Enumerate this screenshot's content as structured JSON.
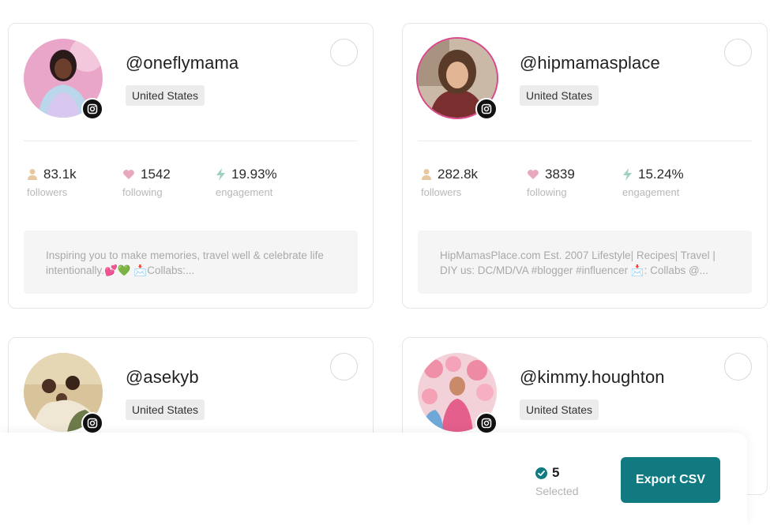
{
  "profiles": [
    {
      "handle": "@oneflymama",
      "country": "United States",
      "followers": "83.1k",
      "following": "1542",
      "engagement": "19.93%",
      "bio": "Inspiring you to make memories, travel well & celebrate life intentionally.💕💚 📩Collabs:...",
      "platform_icon": "instagram-icon"
    },
    {
      "handle": "@hipmamasplace",
      "country": "United States",
      "followers": "282.8k",
      "following": "3839",
      "engagement": "15.24%",
      "bio": "HipMamasPlace.com Est. 2007 Lifestyle| Recipes| Travel | DIY us: DC/MD/VA #blogger #influencer 📩: Collabs @...",
      "platform_icon": "instagram-icon"
    },
    {
      "handle": "@asekyb",
      "country": "United States",
      "platform_icon": "instagram-icon"
    },
    {
      "handle": "@kimmy.houghton",
      "country": "United States",
      "platform_icon": "instagram-icon"
    }
  ],
  "labels": {
    "followers": "followers",
    "following": "following",
    "engagement": "engagement"
  },
  "footer": {
    "selected_count": "5",
    "selected_label": "Selected",
    "export_label": "Export CSV"
  },
  "colors": {
    "accent": "#117a80",
    "heart": "#e8a9bf",
    "person": "#e8c8a0",
    "bolt": "#9fd0c0"
  }
}
